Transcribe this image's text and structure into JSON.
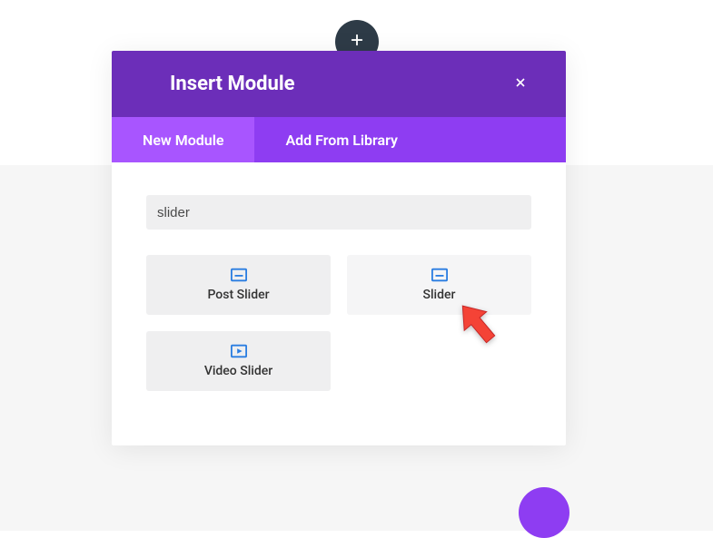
{
  "modal": {
    "title": "Insert Module",
    "tabs": [
      {
        "label": "New Module",
        "active": true
      },
      {
        "label": "Add From Library",
        "active": false
      }
    ],
    "search": {
      "value": "slider",
      "placeholder": ""
    },
    "modules": [
      {
        "label": "Post Slider",
        "icon": "post-slider"
      },
      {
        "label": "Slider",
        "icon": "slider"
      },
      {
        "label": "Video Slider",
        "icon": "video-slider"
      }
    ]
  },
  "colors": {
    "header_purple": "#6c2eb9",
    "tab_purple": "#8e3df2",
    "tab_active": "#a855ff",
    "icon_blue": "#2a7de1",
    "card_bg": "#efeff0",
    "arrow_red": "#f44336"
  }
}
